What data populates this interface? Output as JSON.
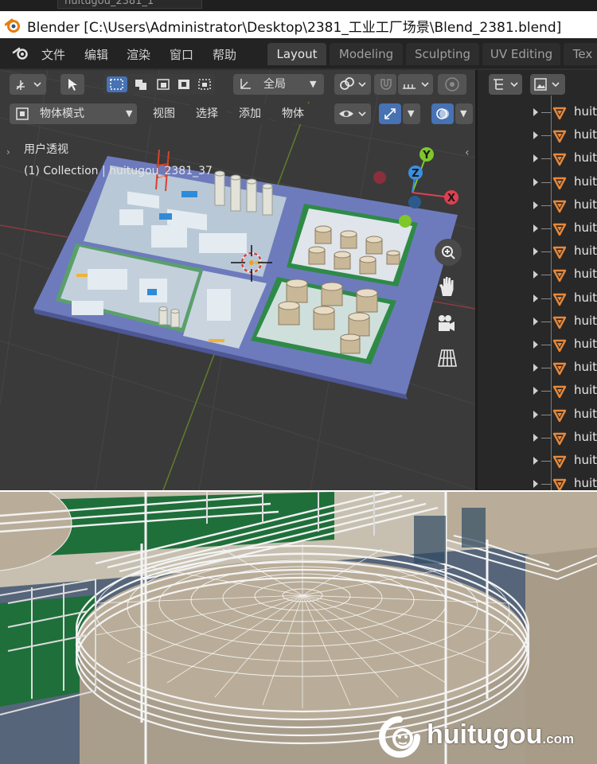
{
  "taskbar": {
    "tab_text": "huitugou_2381_1"
  },
  "window": {
    "title": "Blender [C:\\Users\\Administrator\\Desktop\\2381_工业工厂场景\\Blend_2381.blend]"
  },
  "menu": {
    "items": [
      "文件",
      "编辑",
      "渲染",
      "窗口",
      "帮助"
    ]
  },
  "workspaces": {
    "tabs": [
      "Layout",
      "Modeling",
      "Sculpting",
      "UV Editing",
      "Tex"
    ],
    "active": "Layout"
  },
  "viewport_header": {
    "transform_orientation": "全局",
    "mode": "物体模式",
    "menus": [
      "视图",
      "选择",
      "添加",
      "物体"
    ]
  },
  "viewport": {
    "view_name": "用户透视",
    "collection_info": "(1) Collection | huitugou_2381_37",
    "gizmo_axes": [
      "Y",
      "Z",
      "X"
    ]
  },
  "outliner": {
    "row_label": "huit",
    "row_count": 17
  },
  "watermark": {
    "brand": "huitugou",
    "suffix": ".com"
  },
  "colors": {
    "blender_bg": "#303030",
    "viewport_bg": "#3a3a3a",
    "accent_blue": "#4772b3",
    "axis_x": "#e03f51",
    "axis_y": "#7fc72a",
    "axis_z": "#3a8fe0",
    "object_orange": "#e8883a"
  }
}
